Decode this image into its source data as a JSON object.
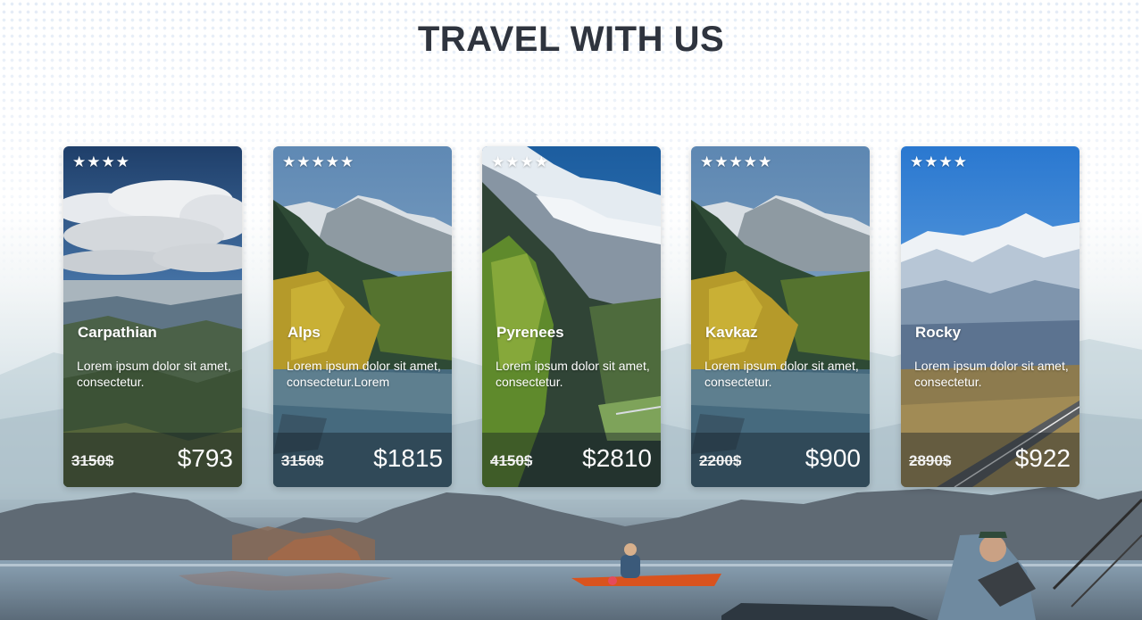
{
  "page": {
    "title": "TRAVEL WITH US"
  },
  "tours": [
    {
      "rating": 4,
      "stars": "★★★★",
      "name": "Carpathian",
      "description": "Lorem ipsum dolor sit amet, consectetur.",
      "old_price": "3150$",
      "price": "$793"
    },
    {
      "rating": 5,
      "stars": "★★★★★",
      "name": "Alps",
      "description": "Lorem ipsum dolor sit amet, consectetur.Lorem",
      "old_price": "3150$",
      "price": "$1815"
    },
    {
      "rating": 4,
      "stars": "★★★★",
      "name": "Pyrenees",
      "description": "Lorem ipsum dolor sit amet, consectetur.",
      "old_price": "4150$",
      "price": "$2810"
    },
    {
      "rating": 5,
      "stars": "★★★★★",
      "name": "Kavkaz",
      "description": "Lorem ipsum dolor sit amet, consectetur.",
      "old_price": "2200$",
      "price": "$900"
    },
    {
      "rating": 4,
      "stars": "★★★★",
      "name": "Rocky",
      "description": "Lorem ipsum dolor sit amet, consectetur.",
      "old_price": "2890$",
      "price": "$922"
    }
  ],
  "colors": {
    "title_text": "#2f343e",
    "card_text": "#ffffff",
    "card_footer": "rgba(20, 28, 36, 0.42)"
  },
  "icons": {
    "star": "star-icon"
  }
}
